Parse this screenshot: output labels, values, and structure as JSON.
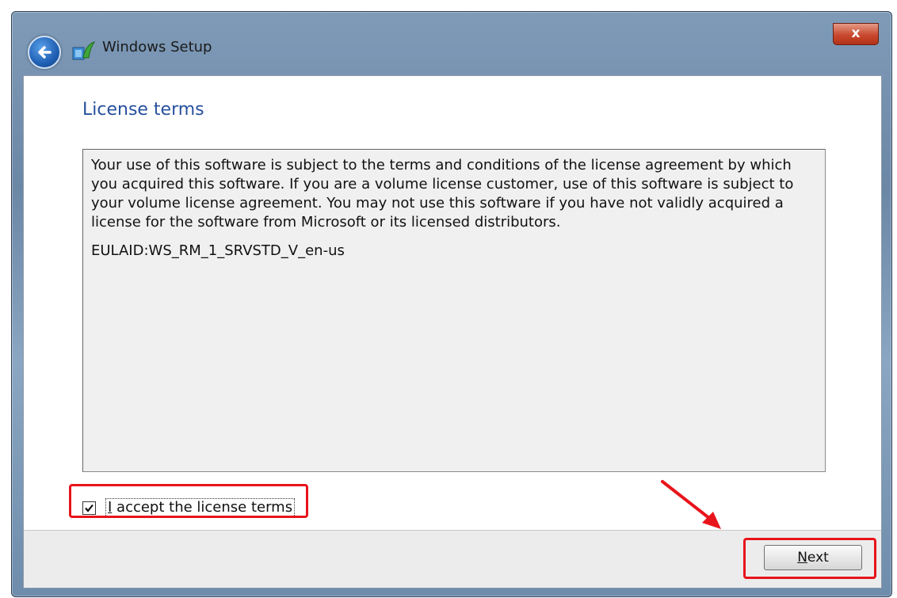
{
  "window": {
    "title": "Windows Setup",
    "close_label": "x"
  },
  "page": {
    "title": "License terms"
  },
  "eula": {
    "paragraph": "Your use of this software is subject to the terms and conditions of the license agreement by which you acquired this software.  If you are a volume license customer, use of this software is subject to your volume license agreement.  You may not use this software if you have not validly acquired a license for the software from Microsoft or its licensed distributors.",
    "id": "EULAID:WS_RM_1_SRVSTD_V_en-us"
  },
  "accept": {
    "label_access_key": "I",
    "label_rest": " accept the license terms",
    "checked": true
  },
  "footer": {
    "next_access_key": "N",
    "next_rest": "ext"
  },
  "annotations": {
    "highlight_color": "#e8141b"
  }
}
